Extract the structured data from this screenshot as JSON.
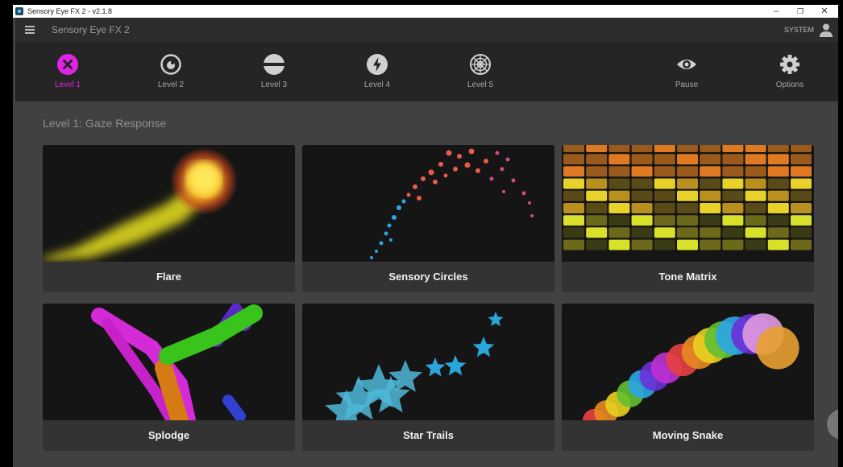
{
  "window": {
    "title": "Sensory Eye FX 2 - v2.1.8",
    "controls": {
      "minimize": "–",
      "maximize": "❐",
      "close": "✕"
    }
  },
  "appbar": {
    "title": "Sensory Eye FX 2",
    "user": "SYSTEM"
  },
  "nav": [
    {
      "label": "Level 1",
      "icon": "close-circle-icon"
    },
    {
      "label": "Level 2",
      "icon": "eye-target-icon"
    },
    {
      "label": "Level 3",
      "icon": "half-circle-icon"
    },
    {
      "label": "Level 4",
      "icon": "lightning-icon"
    },
    {
      "label": "Level 5",
      "icon": "web-icon"
    },
    {
      "label": "Pause",
      "icon": "eye-icon"
    },
    {
      "label": "Options",
      "icon": "gear-icon"
    }
  ],
  "colors": {
    "accent": "#e024e6",
    "background": "#414141",
    "navbar": "#252525",
    "card": "#333333"
  },
  "page": {
    "heading": "Level 1: Gaze Response"
  },
  "cards": [
    {
      "label": "Flare"
    },
    {
      "label": "Sensory Circles"
    },
    {
      "label": "Tone Matrix"
    },
    {
      "label": "Splodge"
    },
    {
      "label": "Star Trails"
    },
    {
      "label": "Moving Snake"
    }
  ]
}
